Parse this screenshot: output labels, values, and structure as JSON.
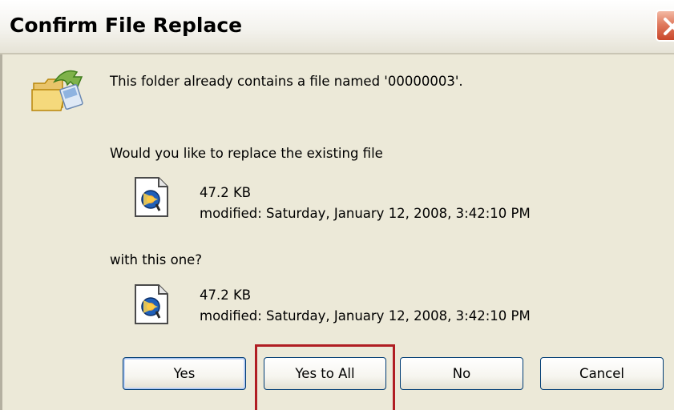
{
  "dialog": {
    "title": "Confirm File Replace",
    "message": "This folder already contains a file named '00000003'.",
    "question": "Would you like to replace the existing file",
    "existing_file": {
      "size": "47.2 KB",
      "modified": "modified: Saturday, January 12, 2008, 3:42:10 PM"
    },
    "with_label": "with this one?",
    "new_file": {
      "size": "47.2 KB",
      "modified": "modified: Saturday, January 12, 2008, 3:42:10 PM"
    },
    "buttons": {
      "yes": "Yes",
      "yes_to_all": "Yes to All",
      "no": "No",
      "cancel": "Cancel"
    }
  },
  "icons": {
    "title_close": "close-icon",
    "folder": "folder-move-icon",
    "file": "media-file-icon"
  },
  "colors": {
    "dialog_bg": "#ece9d8",
    "close_red": "#c9462a",
    "button_border": "#003c74",
    "highlight": "#b01e23"
  }
}
